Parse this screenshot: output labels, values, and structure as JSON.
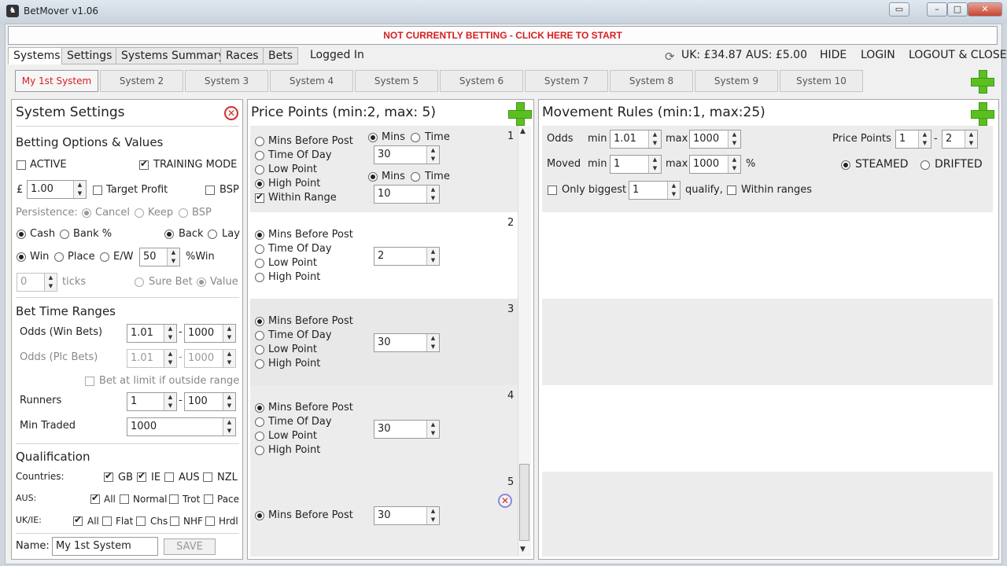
{
  "window": {
    "title": "BetMover v1.06",
    "app_icon": "horse-icon"
  },
  "banner": {
    "text": "NOT CURRENTLY BETTING - CLICK HERE TO START"
  },
  "menu": {
    "tabs": [
      "Systems",
      "Settings",
      "Systems Summary",
      "Races",
      "Bets"
    ],
    "status": "Logged In",
    "balance": "UK: £34.87  AUS: £5.00",
    "hide": "HIDE",
    "login": "LOGIN",
    "logout": "LOGOUT & CLOSE"
  },
  "system_tabs": [
    "My 1st System",
    "System 2",
    "System 3",
    "System 4",
    "System 5",
    "System 6",
    "System 7",
    "System 8",
    "System 9",
    "System 10"
  ],
  "settings": {
    "title": "System Settings",
    "betting_heading": "Betting Options & Values",
    "active": "ACTIVE",
    "training": "TRAINING MODE",
    "currency": "£",
    "stake": "1.00",
    "target_profit": "Target Profit",
    "bsp": "BSP",
    "persistence": "Persistence:",
    "cancel": "Cancel",
    "keep": "Keep",
    "bsp2": "BSP",
    "cash": "Cash",
    "bank": "Bank %",
    "back": "Back",
    "lay": "Lay",
    "win": "Win",
    "place": "Place",
    "ew": "E/W",
    "ew_value": "50",
    "pct_win": "%Win",
    "ticks_value": "0",
    "ticks": "ticks",
    "sure_bet": "Sure Bet",
    "value": "Value",
    "time_heading": "Bet Time Ranges",
    "odds_win": "Odds (Win Bets)",
    "odds_win_min": "1.01",
    "odds_win_max": "1000",
    "odds_plc": "Odds (Plc Bets)",
    "odds_plc_min": "1.01",
    "odds_plc_max": "1000",
    "bet_limit": "Bet at limit if outside range",
    "runners": "Runners",
    "runners_min": "1",
    "runners_max": "100",
    "min_traded": "Min Traded",
    "min_traded_value": "1000",
    "qual_heading": "Qualification",
    "countries": "Countries:",
    "gb": "GB",
    "ie": "IE",
    "aus": "AUS",
    "nzl": "NZL",
    "aus_label": "AUS:",
    "all": "All",
    "normal": "Normal",
    "trot": "Trot",
    "pace": "Pace",
    "ukie_label": "UK/IE:",
    "all2": "All",
    "flat": "Flat",
    "chs": "Chs",
    "nhf": "NHF",
    "hrdl": "Hrdl",
    "name_label": "Name:",
    "name_value": "My 1st System",
    "save": "SAVE"
  },
  "price_points": {
    "title": "Price Points (min:2, max: 5)",
    "opt_mins_before": "Mins Before Post",
    "opt_time_of_day": "Time Of Day",
    "opt_low": "Low Point",
    "opt_high": "High Point",
    "opt_within": "Within Range",
    "mins": "Mins",
    "time": "Time",
    "rows": [
      {
        "num": "1",
        "v1": "30",
        "v2": "10"
      },
      {
        "num": "2",
        "v1": "2"
      },
      {
        "num": "3",
        "v1": "30"
      },
      {
        "num": "4",
        "v1": "30"
      },
      {
        "num": "5",
        "v1": "30"
      }
    ]
  },
  "movement": {
    "title": "Movement Rules (min:1, max:25)",
    "odds": "Odds",
    "moved": "Moved",
    "min": "min",
    "max": "max",
    "odds_min": "1.01",
    "odds_max": "1000",
    "moved_min": "1",
    "moved_max": "1000",
    "pct": "%",
    "price_points": "Price Points",
    "pp_from": "1",
    "pp_dash": "-",
    "pp_to": "2",
    "steamed": "STEAMED",
    "drifted": "DRIFTED",
    "only_biggest": "Only biggest",
    "biggest_value": "1",
    "qualify": "qualify,",
    "within_ranges": "Within ranges"
  }
}
